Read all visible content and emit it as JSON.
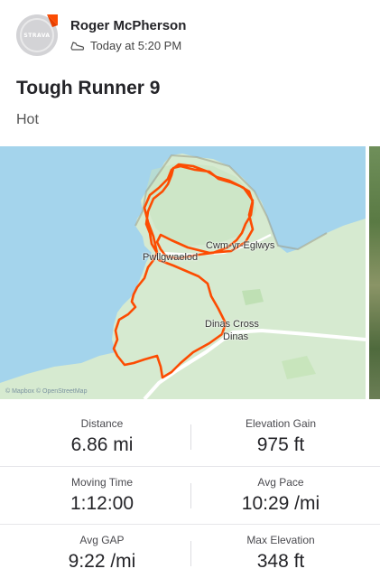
{
  "athlete": {
    "name": "Roger McPherson",
    "avatar_text": "STRAVA",
    "timestamp": "Today at 5:20 PM",
    "activity_icon": "shoe-icon",
    "badge_color": "#fc4c02"
  },
  "activity": {
    "title": "Tough Runner 9",
    "description": "Hot"
  },
  "map": {
    "labels": {
      "cwm": "Cwm-yr-Eglwys",
      "pwll": "Pwllgwaelod",
      "dinas_cross": "Dinas Cross",
      "dinas": "Dinas"
    },
    "attribution": "© Mapbox © OpenStreetMap",
    "route_color": "#fc4c02"
  },
  "stats": [
    {
      "left": {
        "label": "Distance",
        "value": "6.86 mi"
      },
      "right": {
        "label": "Elevation Gain",
        "value": "975 ft"
      }
    },
    {
      "left": {
        "label": "Moving Time",
        "value": "1:12:00"
      },
      "right": {
        "label": "Avg Pace",
        "value": "10:29 /mi"
      }
    },
    {
      "left": {
        "label": "Avg GAP",
        "value": "9:22 /mi"
      },
      "right": {
        "label": "Max Elevation",
        "value": "348 ft"
      }
    }
  ]
}
